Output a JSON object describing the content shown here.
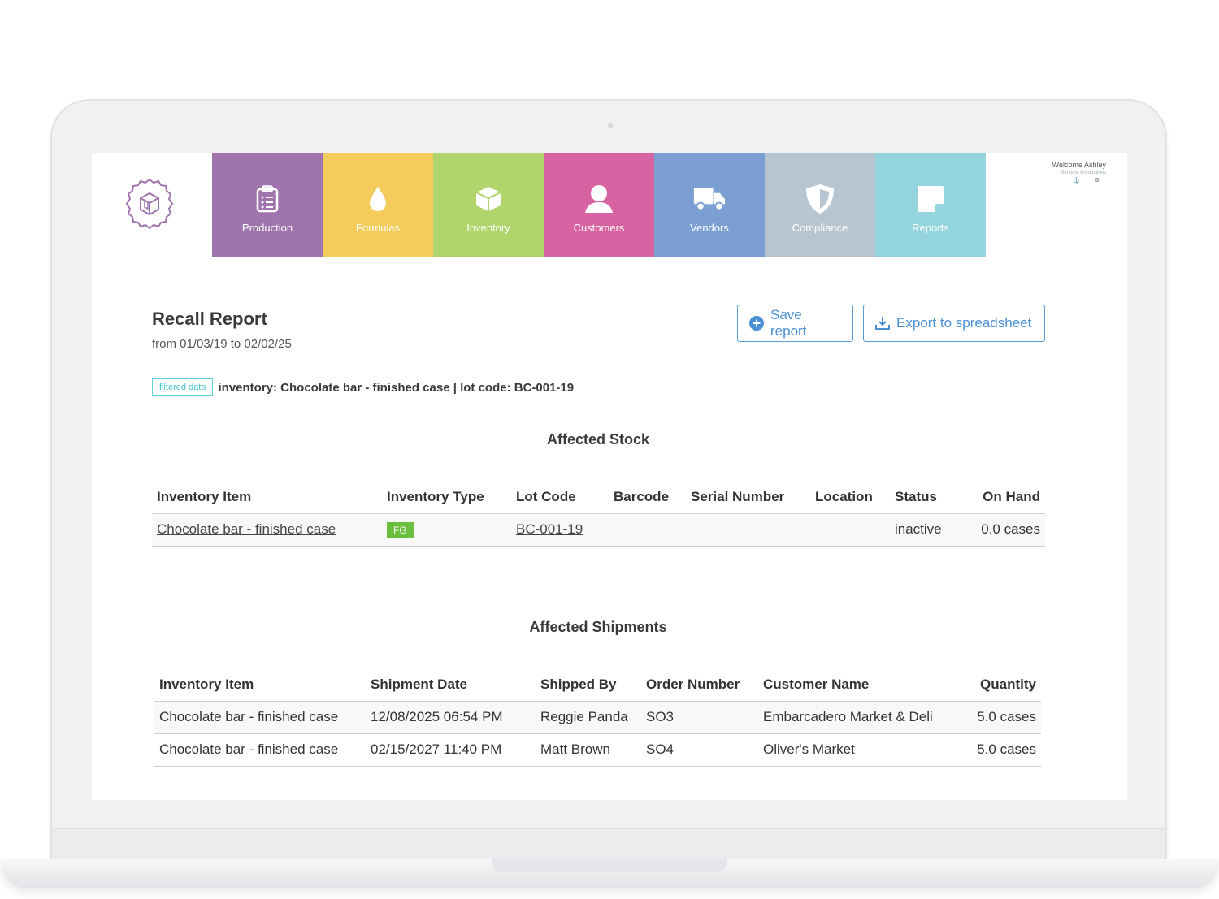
{
  "header": {
    "welcome_prefix": "Welcome",
    "user_name": "Ashley",
    "company": "Sonoma Productions",
    "controls": "⚓ ⚙"
  },
  "nav": {
    "items": [
      {
        "label": "Production",
        "icon": "clipboard-icon"
      },
      {
        "label": "Formulas",
        "icon": "drop-icon"
      },
      {
        "label": "Inventory",
        "icon": "box-icon"
      },
      {
        "label": "Customers",
        "icon": "user-icon"
      },
      {
        "label": "Vendors",
        "icon": "truck-icon"
      },
      {
        "label": "Compliance",
        "icon": "shield-icon"
      },
      {
        "label": "Reports",
        "icon": "note-icon"
      }
    ]
  },
  "report": {
    "title": "Recall Report",
    "date_range": "from 01/03/19 to 02/02/25",
    "save_label": "Save report",
    "export_label": "Export to spreadsheet",
    "filter_tag": "filtered data",
    "filter_text": "inventory: Chocolate bar - finished case | lot code: BC-001-19"
  },
  "affected_stock": {
    "title": "Affected Stock",
    "columns": [
      "Inventory Item",
      "Inventory Type",
      "Lot Code",
      "Barcode",
      "Serial Number",
      "Location",
      "Status",
      "On Hand"
    ],
    "rows": [
      {
        "item": "Chocolate bar - finished case",
        "type": "FG",
        "lot": "BC-001-19",
        "barcode": "",
        "serial": "",
        "location": "",
        "status": "inactive",
        "on_hand": "0.0 cases"
      }
    ]
  },
  "affected_shipments": {
    "title": "Affected Shipments",
    "columns": [
      "Inventory Item",
      "Shipment Date",
      "Shipped By",
      "Order Number",
      "Customer Name",
      "Quantity"
    ],
    "rows": [
      {
        "item": "Chocolate bar - finished case",
        "date": "12/08/2025 06:54 PM",
        "shipped_by": "Reggie Panda",
        "order": "SO3",
        "customer": "Embarcadero Market & Deli",
        "quantity": "5.0 cases"
      },
      {
        "item": "Chocolate bar - finished case",
        "date": "02/15/2027 11:40 PM",
        "shipped_by": "Matt Brown",
        "order": "SO4",
        "customer": "Oliver's Market",
        "quantity": "5.0 cases"
      }
    ]
  },
  "colors": {
    "production": "#a075ae",
    "formulas": "#f4cc5c",
    "inventory": "#b0d56c",
    "customers": "#d863a2",
    "vendors": "#7b9fd3",
    "compliance": "#b6c5cf",
    "reports": "#93d4df",
    "accent": "#4a8fd4",
    "fg_badge": "#6bbf3e"
  }
}
